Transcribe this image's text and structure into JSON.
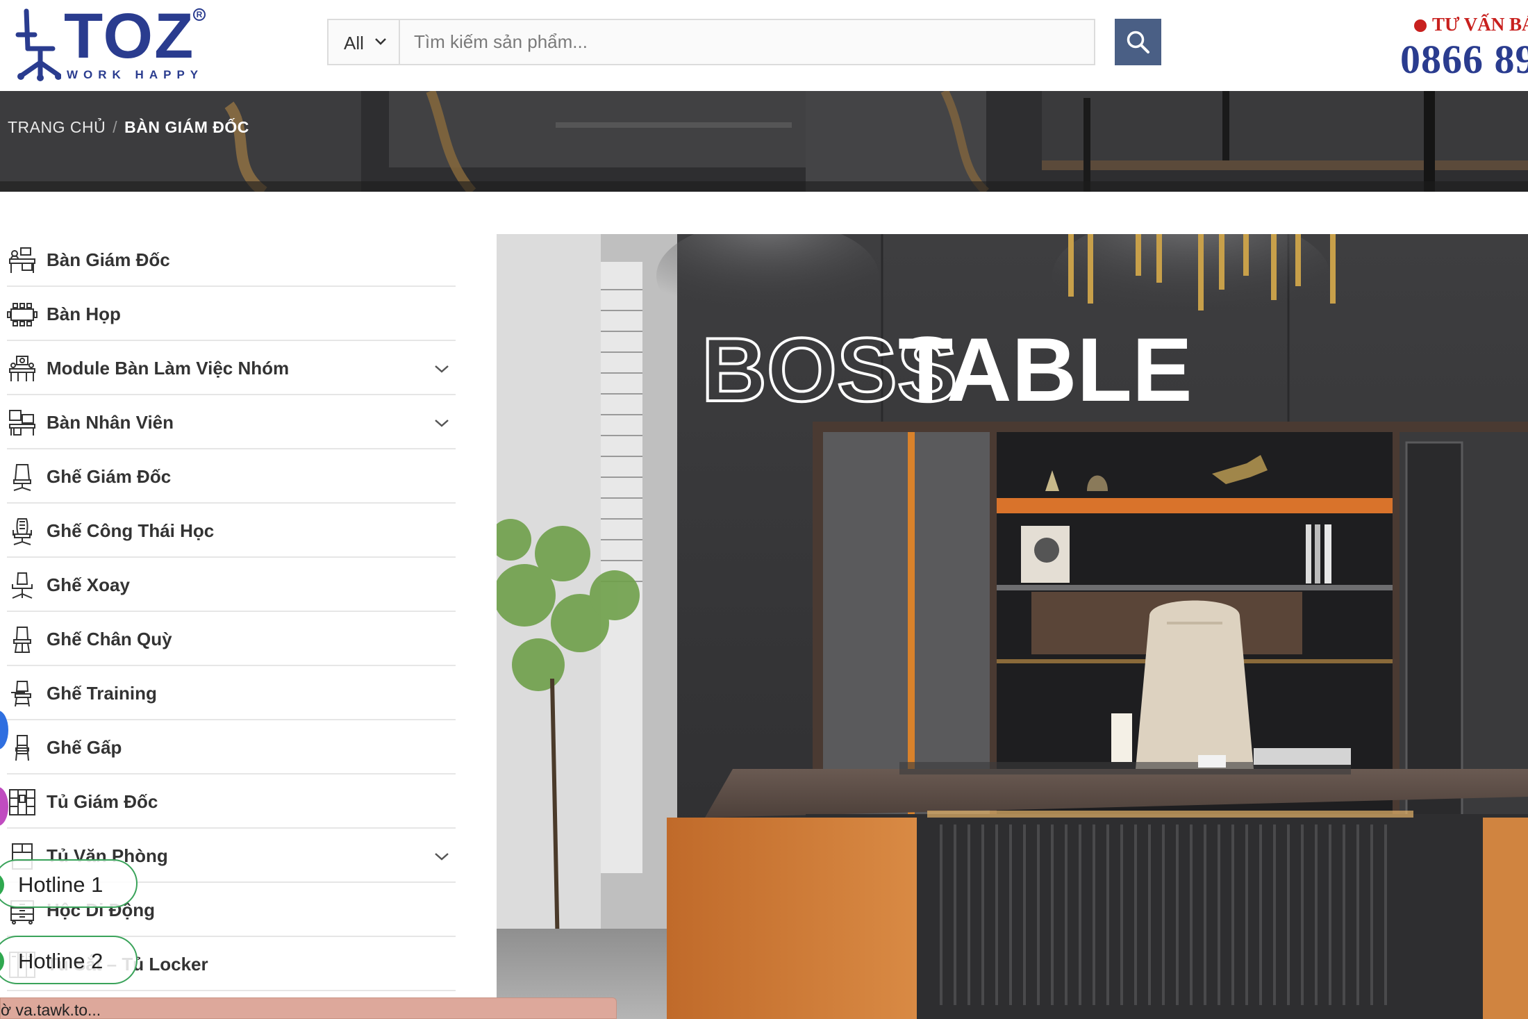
{
  "header": {
    "logo": {
      "brand": "TOZ",
      "tagline": "WORK HAPPY"
    },
    "search": {
      "category_label": "All",
      "placeholder": "Tìm kiếm sản phẩm..."
    },
    "consult_label": "TƯ VẤN BÁ",
    "phone": "0866 89"
  },
  "breadcrumb": {
    "home": "TRANG CHỦ",
    "separator": "/",
    "current": "BÀN GIÁM ĐỐC"
  },
  "sidebar": {
    "items": [
      {
        "label": "Bàn Giám Đốc",
        "icon": "executive-desk-icon",
        "expandable": false
      },
      {
        "label": "Bàn Họp",
        "icon": "meeting-table-icon",
        "expandable": false
      },
      {
        "label": "Module Bàn Làm Việc Nhóm",
        "icon": "team-desk-icon",
        "expandable": true
      },
      {
        "label": "Bàn Nhân Viên",
        "icon": "staff-desk-icon",
        "expandable": true
      },
      {
        "label": "Ghế Giám Đốc",
        "icon": "executive-chair-icon",
        "expandable": false
      },
      {
        "label": "Ghế Công Thái Học",
        "icon": "ergonomic-chair-icon",
        "expandable": false
      },
      {
        "label": "Ghế Xoay",
        "icon": "swivel-chair-icon",
        "expandable": false
      },
      {
        "label": "Ghế Chân Quỳ",
        "icon": "sled-chair-icon",
        "expandable": false
      },
      {
        "label": "Ghế Training",
        "icon": "training-chair-icon",
        "expandable": false
      },
      {
        "label": "Ghế Gấp",
        "icon": "folding-chair-icon",
        "expandable": false
      },
      {
        "label": "Tủ Giám Đốc",
        "icon": "executive-cabinet-icon",
        "expandable": false
      },
      {
        "label": "Tủ Văn Phòng",
        "icon": "office-cabinet-icon",
        "expandable": true
      },
      {
        "label": "Hộc Di Động",
        "icon": "mobile-pedestal-icon",
        "expandable": false
      },
      {
        "label": "Tủ Sắt – Tủ Locker",
        "icon": "locker-icon",
        "expandable": false
      }
    ]
  },
  "hero": {
    "headline_outline": "BOSS",
    "headline_solid": "TABLE"
  },
  "widgets": {
    "hotline1": "Hotline 1",
    "hotline2": "Hotline 2",
    "status_text": "ờ va.tawk.to..."
  },
  "colors": {
    "brand_blue": "#2a3c8f",
    "search_button": "#4a5f85",
    "consult_red": "#c8201e",
    "hotline_green": "#2fa84f",
    "status_bar": "#dda89b"
  }
}
